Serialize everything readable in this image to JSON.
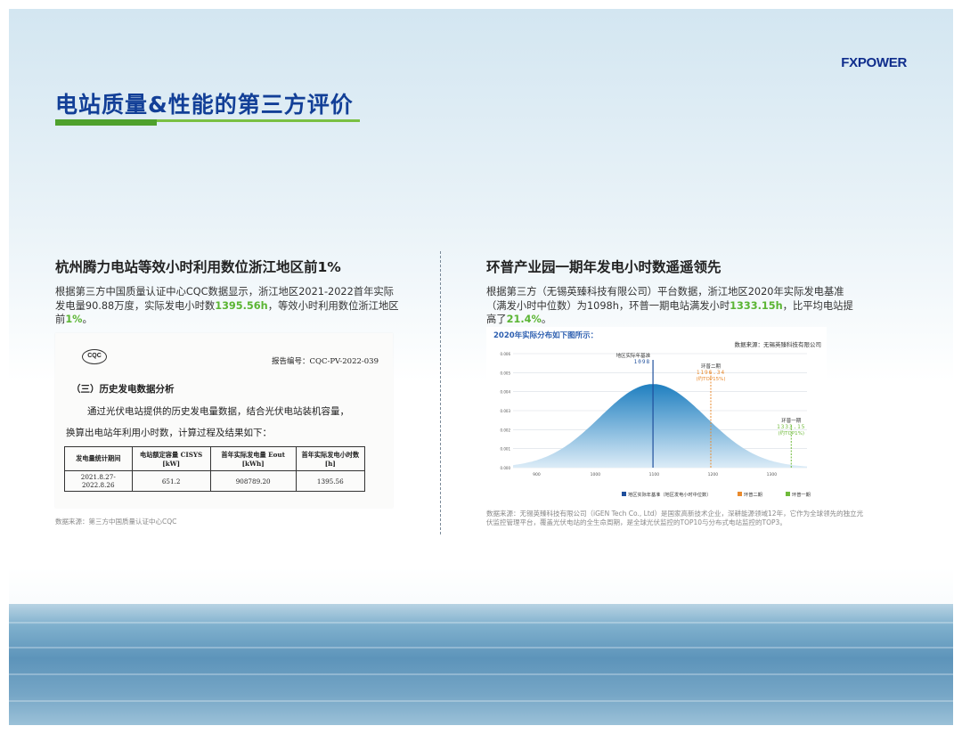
{
  "brand": {
    "logo": "FXPOWER"
  },
  "title": "电站质量&性能的第三方评价",
  "left": {
    "heading": "杭州腾力电站等效小时利用数位浙江地区前1%",
    "para": [
      {
        "t": "根据第三方中国质量认证中心CQC数据显示，浙江地区2021-2022首年实际发电量90.88万度，实际发电小时数"
      },
      {
        "t": "1395.56h",
        "hl": true
      },
      {
        "t": "，等效小时利用数位浙江地区前"
      },
      {
        "t": "1%",
        "hl": true
      },
      {
        "t": "。"
      }
    ],
    "document": {
      "seal": "CQC",
      "report_no": "报告编号：CQC-PV-2022-039",
      "section": "（三）历史发电数据分析",
      "line1": "通过光伏电站提供的历史发电量数据，结合光伏电站装机容量，",
      "line2": "换算出电站年利用小时数，计算过程及结果如下：",
      "table": {
        "headers": [
          "发电量统计期间",
          "电站额定容量 CISYS [kW]",
          "首年实际发电量 Eout [kWh]",
          "首年实际发电小时数 [h]"
        ],
        "rows": [
          [
            "2021.8.27-2022.8.26",
            "651.2",
            "908789.20",
            "1395.56"
          ]
        ]
      }
    },
    "source": "数据来源：第三方中国质量认证中心CQC"
  },
  "right": {
    "heading": "环普产业园一期年发电小时数遥遥领先",
    "para": [
      {
        "t": "根据第三方（无锡英臻科技有限公司）平台数据，浙江地区2020年实际发电基准（满发小时中位数）为1098h，环普一期电站满发小时"
      },
      {
        "t": "1333.15h",
        "hl": true
      },
      {
        "t": "，比平均电站提高了"
      },
      {
        "t": "21.4%",
        "hl": true
      },
      {
        "t": "。"
      }
    ],
    "source": "数据来源：无锡英臻科技有限公司（iGEN Tech Co., Ltd）是国家高新技术企业，深耕能源领域12年，它作为全球领先的独立光伏监控管理平台，覆盖光伏电站的全生命周期，是全球光伏监控的TOP10与分布式电站监控的TOP3。"
  },
  "chart_data": {
    "type": "area",
    "caption": "2020年实际分布如下图所示：",
    "source_note": "数据来源：无锡英臻科技有限公司",
    "x_ticks": [
      "900",
      "1000",
      "1100",
      "1200",
      "1300"
    ],
    "xlim": [
      860,
      1360
    ],
    "y_ticks": [
      "0.006",
      "0.005",
      "0.004",
      "0.003",
      "0.002",
      "0.001",
      "0.000"
    ],
    "ylim": [
      0,
      0.006
    ],
    "distribution": {
      "mean": 1098,
      "sd": 90,
      "peak": 0.0044
    },
    "markers": [
      {
        "name": "地区实际年基准（地区发电小时中位数）",
        "value": 1098,
        "label": "地区实际年基准",
        "sublabel": "1098",
        "color": "#1f4f9c"
      },
      {
        "name": "环普二期",
        "value": 1196.34,
        "label": "环普二期",
        "sublabel": "1196.34",
        "note": "(约TOP15%)",
        "color": "#e98a2d"
      },
      {
        "name": "环普一期",
        "value": 1333.15,
        "label": "环普一期",
        "sublabel": "1333.15",
        "note": "(约TOP1%)",
        "color": "#6fba3a"
      }
    ],
    "legend": [
      {
        "label": "地区实际年基准（地区发电小时中位数）",
        "color": "#1f4f9c"
      },
      {
        "label": "环普二期",
        "color": "#e98a2d"
      },
      {
        "label": "环普一期",
        "color": "#6fba3a"
      }
    ],
    "legend_position": "bottom-right",
    "grid": true
  }
}
